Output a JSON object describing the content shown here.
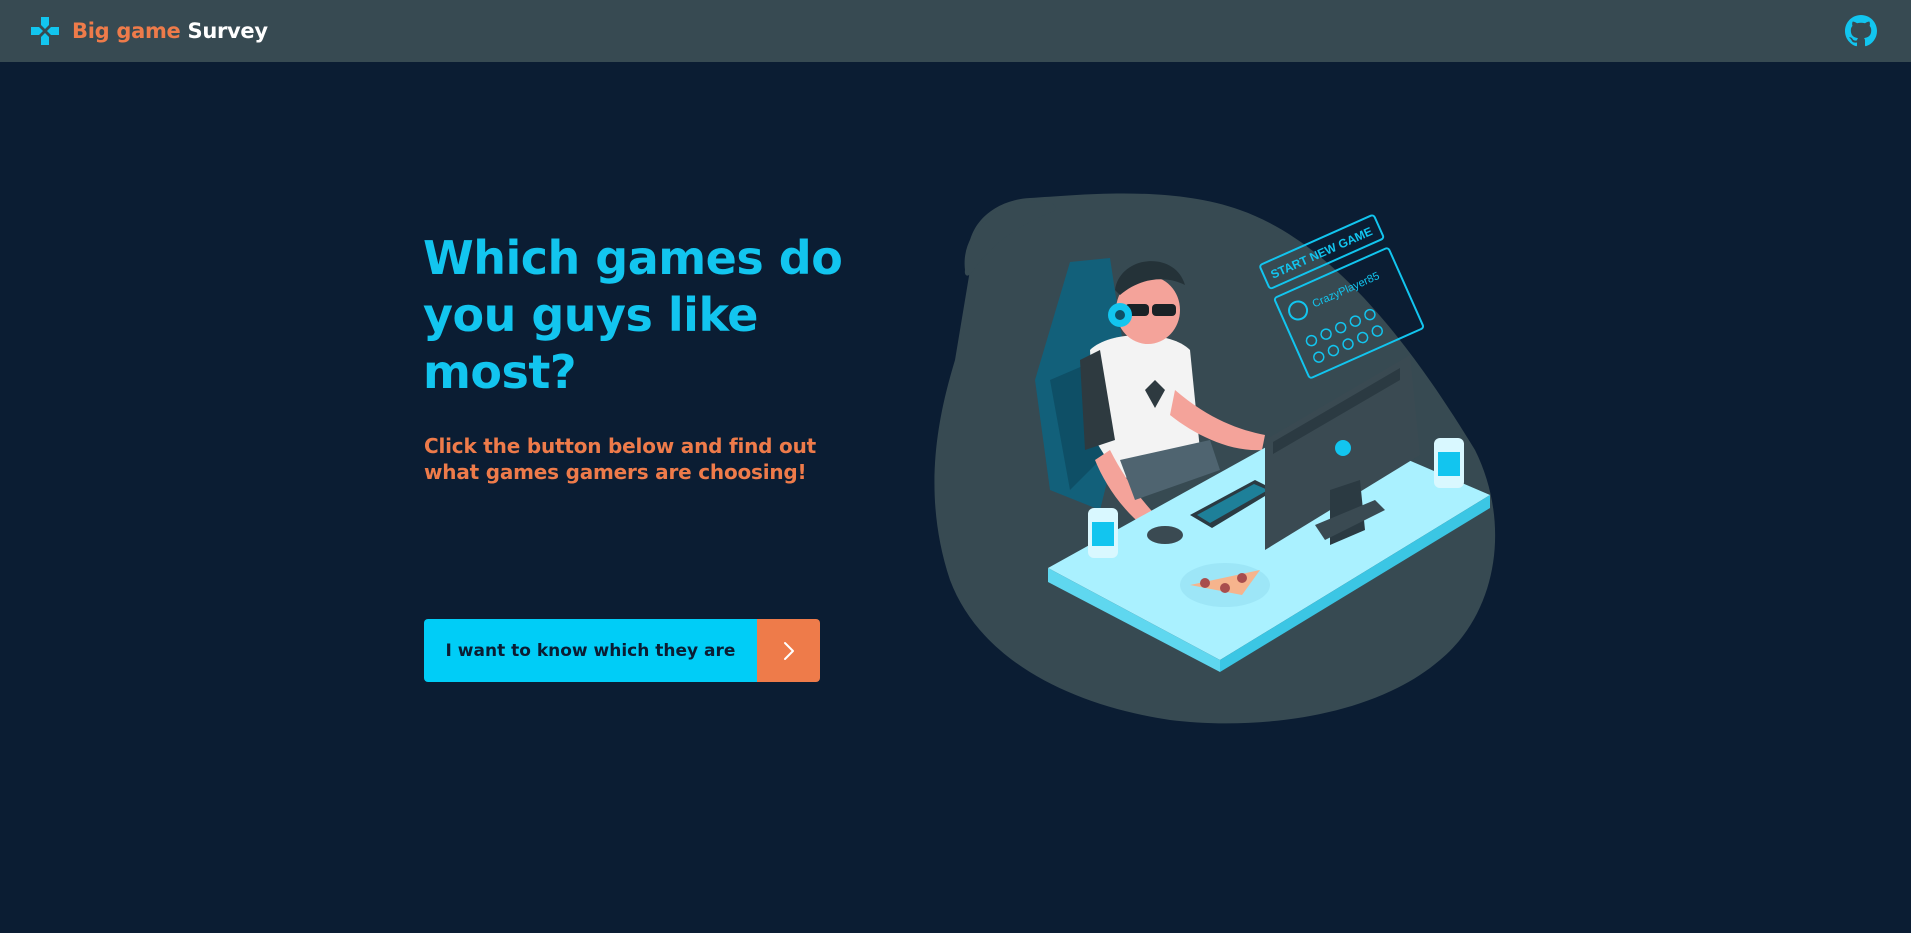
{
  "header": {
    "brand_part1": "Big game",
    "brand_part2": "Survey",
    "logo_icon": "gamepad-cross-icon",
    "github_icon": "github-icon"
  },
  "hero": {
    "title": "Which games do you guys like most?",
    "subtitle": "Click the button below and find out what games gamers are choosing!",
    "cta_label": "I want to know which they are",
    "cta_icon": "chevron-right-icon"
  },
  "illustration": {
    "screen_title": "START NEW GAME",
    "player_name": "CrazyPlayer85"
  },
  "colors": {
    "background": "#0b1d33",
    "topbar": "#374a52",
    "accent_cyan": "#00cdf7",
    "accent_orange": "#ee7b4a"
  }
}
